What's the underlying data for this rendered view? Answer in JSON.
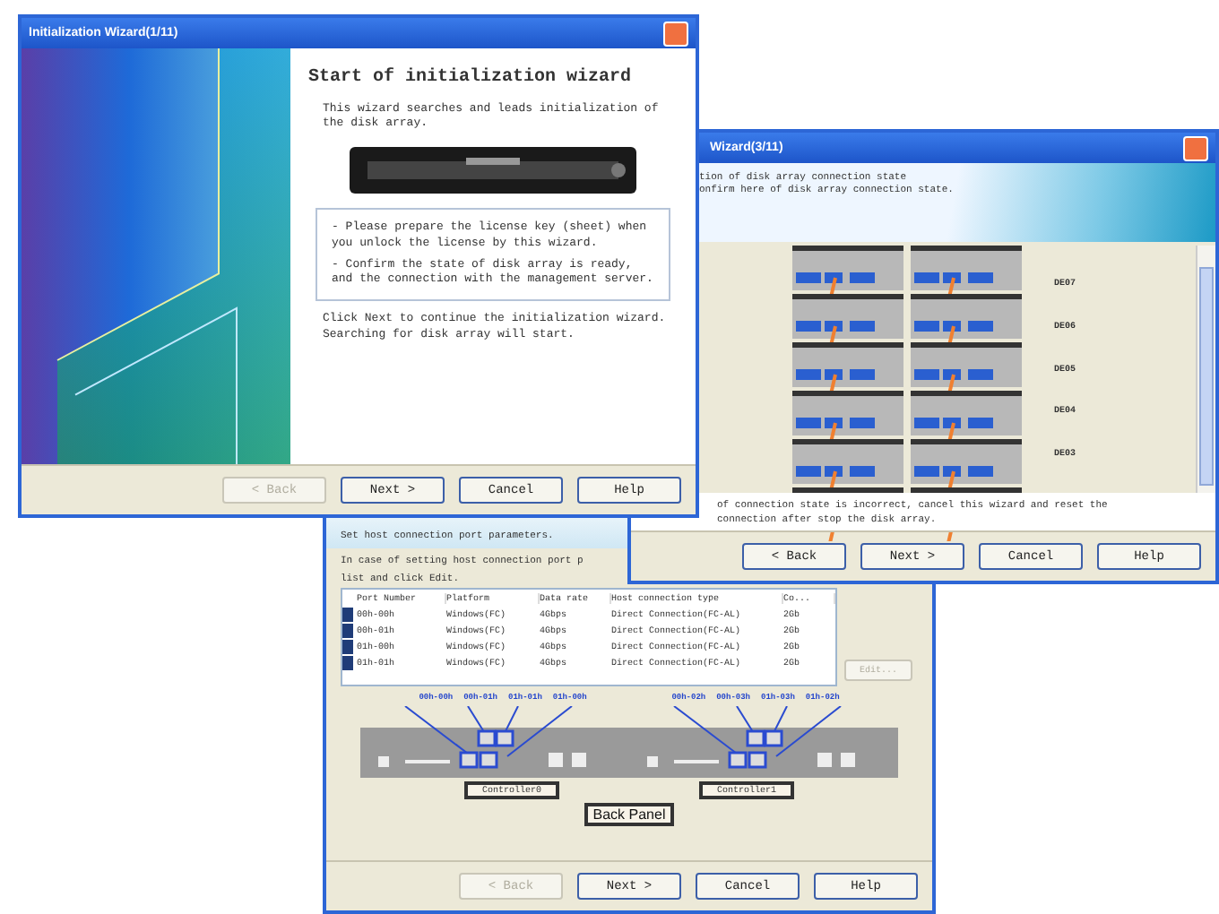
{
  "windows": [
    {
      "kind": "start",
      "title": "Initialization Wizard(1/11)",
      "heading": "Start of initialization wizard",
      "intro": "This wizard searches and leads initialization of the disk array.",
      "notes": [
        "- Please prepare the license key (sheet) when you unlock the license by this wizard.",
        "- Confirm the state of disk array is ready, and the connection with the management server."
      ],
      "outro": [
        "Click Next to continue the initialization wizard.",
        "Searching for disk array will start."
      ],
      "buttons": [
        {
          "label": "< Back",
          "disabled": true
        },
        {
          "label": "Next >",
          "disabled": false
        },
        {
          "label": "Cancel",
          "disabled": false
        },
        {
          "label": "Help",
          "disabled": false
        }
      ]
    },
    {
      "kind": "connection",
      "title": "Wizard(3/11)",
      "header": [
        "tion of disk array connection state",
        "onfirm here of disk array connection state."
      ],
      "enclosures": [
        "DE07",
        "DE06",
        "DE05",
        "DE04",
        "DE03"
      ],
      "footer": [
        "of connection state is incorrect, cancel this wizard and reset the",
        "connection after stop the disk array."
      ],
      "buttons": [
        {
          "label": "< Back",
          "disabled": false
        },
        {
          "label": "Next >",
          "disabled": false
        },
        {
          "label": "Cancel",
          "disabled": false
        },
        {
          "label": "Help",
          "disabled": false
        }
      ]
    },
    {
      "kind": "hosts",
      "header": "Set host connection port parameters.",
      "intro": [
        "In case of setting host connection port p",
        "list and click Edit."
      ],
      "table": {
        "columns": [
          "Port Number",
          "Platform",
          "Data rate",
          "Host connection type",
          "Co..."
        ],
        "rows": [
          {
            "selected": true,
            "cells": [
              "00h-00h",
              "Windows(FC)",
              "4Gbps",
              "Direct Connection(FC-AL)",
              "2Gb"
            ]
          },
          {
            "selected": true,
            "cells": [
              "00h-01h",
              "Windows(FC)",
              "4Gbps",
              "Direct Connection(FC-AL)",
              "2Gb"
            ]
          },
          {
            "selected": true,
            "cells": [
              "01h-00h",
              "Windows(FC)",
              "4Gbps",
              "Direct Connection(FC-AL)",
              "2Gb"
            ]
          },
          {
            "selected": true,
            "cells": [
              "01h-01h",
              "Windows(FC)",
              "4Gbps",
              "Direct Connection(FC-AL)",
              "2Gb"
            ]
          }
        ]
      },
      "edit_button": {
        "label": "Edit...",
        "disabled": true
      },
      "port_labels": [
        "00h-00h",
        "00h-01h",
        "01h-01h",
        "01h-00h",
        "00h-02h",
        "00h-03h",
        "01h-03h",
        "01h-02h"
      ],
      "controllers": [
        "Controller0",
        "Controller1"
      ],
      "panel_label": "Back Panel",
      "buttons": [
        {
          "label": "< Back",
          "disabled": true
        },
        {
          "label": "Next >",
          "disabled": false
        },
        {
          "label": "Cancel",
          "disabled": false
        },
        {
          "label": "Help",
          "disabled": false
        }
      ]
    }
  ]
}
